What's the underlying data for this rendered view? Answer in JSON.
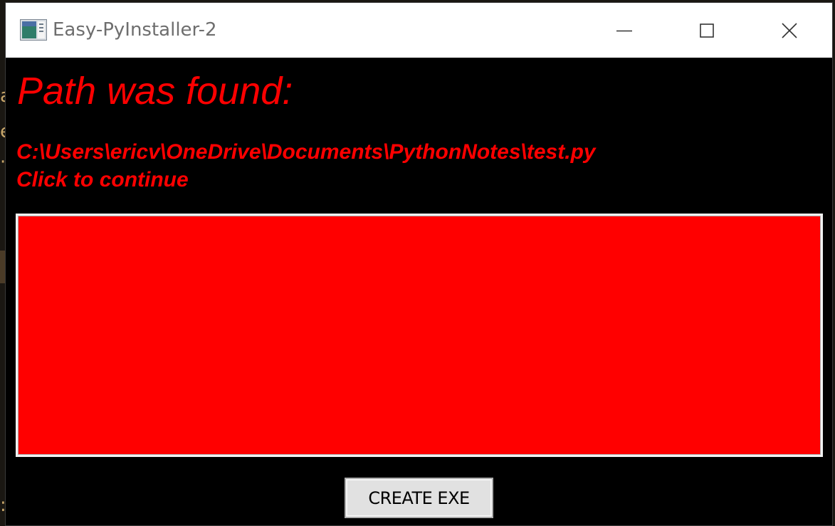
{
  "window": {
    "title": "Easy-PyInstaller-2",
    "icon": "app-window-icon"
  },
  "title_buttons": {
    "minimize": "minimize-icon",
    "maximize": "maximize-icon",
    "close": "close-icon"
  },
  "desktop": {
    "fragments": [
      "a",
      "e",
      "·",
      ":"
    ]
  },
  "main": {
    "heading": "Path was found:",
    "path": "C:\\Users\\ericv\\OneDrive\\Documents\\PythonNotes\\test.py",
    "instruction": "Click to continue",
    "panel_color": "#ff0000",
    "create_button_label": "CREATE EXE"
  },
  "colors": {
    "text": "#ff0000",
    "background": "#000000",
    "panel": "#ff0000"
  }
}
